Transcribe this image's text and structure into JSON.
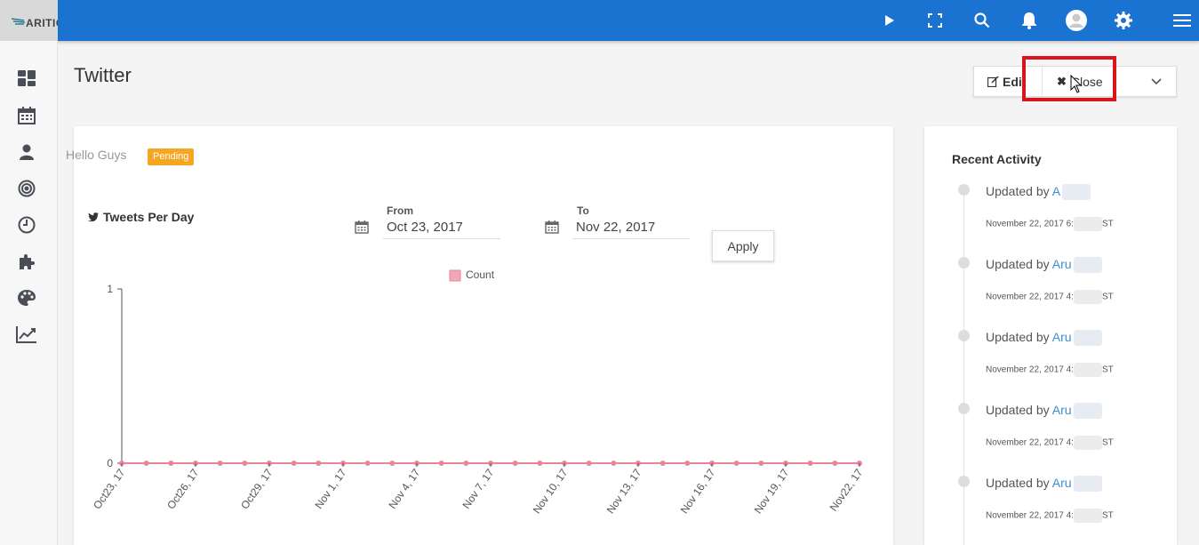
{
  "app": {
    "logo_text": "ARITIC"
  },
  "page": {
    "title": "Twitter"
  },
  "toolbar": {
    "edit_label": "Edit",
    "close_label": "Close"
  },
  "post": {
    "text": "Hello Guys",
    "status": "Pending"
  },
  "chart_panel": {
    "title": "Tweets Per Day",
    "from_label": "From",
    "from_value": "Oct 23, 2017",
    "to_label": "To",
    "to_value": "Nov 22, 2017",
    "apply_label": "Apply"
  },
  "chart_data": {
    "type": "line",
    "legend": [
      {
        "name": "Count",
        "color": "#f4a6b5"
      }
    ],
    "ylim": [
      0,
      1
    ],
    "y_ticks": [
      "0",
      "1"
    ],
    "x_tick_labels": [
      "Oct23, 17",
      "Oct26, 17",
      "Oct29, 17",
      "Nov 1, 17",
      "Nov 4, 17",
      "Nov 7, 17",
      "Nov 10, 17",
      "Nov 13, 17",
      "Nov 16, 17",
      "Nov 19, 17",
      "Nov22, 17"
    ],
    "series": [
      {
        "name": "Count",
        "values": [
          0,
          0,
          0,
          0,
          0,
          0,
          0,
          0,
          0,
          0,
          0,
          0,
          0,
          0,
          0,
          0,
          0,
          0,
          0,
          0,
          0,
          0,
          0,
          0,
          0,
          0,
          0,
          0,
          0,
          0,
          0
        ],
        "color": "#e9849a"
      }
    ]
  },
  "activity": {
    "title": "Recent Activity",
    "items": [
      {
        "prefix": "Updated by",
        "user": "A",
        "date": "November 22, 2017 6:",
        "tail": "ST"
      },
      {
        "prefix": "Updated by",
        "user": "Aru",
        "date": "November 22, 2017 4:",
        "tail": "ST"
      },
      {
        "prefix": "Updated by",
        "user": "Aru",
        "date": "November 22, 2017 4:",
        "tail": "ST"
      },
      {
        "prefix": "Updated by",
        "user": "Aru",
        "date": "November 22, 2017 4:",
        "tail": "ST"
      },
      {
        "prefix": "Updated by",
        "user": "Aru",
        "date": "November 22, 2017 4:",
        "tail": "ST"
      }
    ]
  },
  "colors": {
    "topbar": "#1a73d0",
    "badge": "#f5a623",
    "highlight": "#d9141a",
    "link": "#3b8fd4"
  }
}
